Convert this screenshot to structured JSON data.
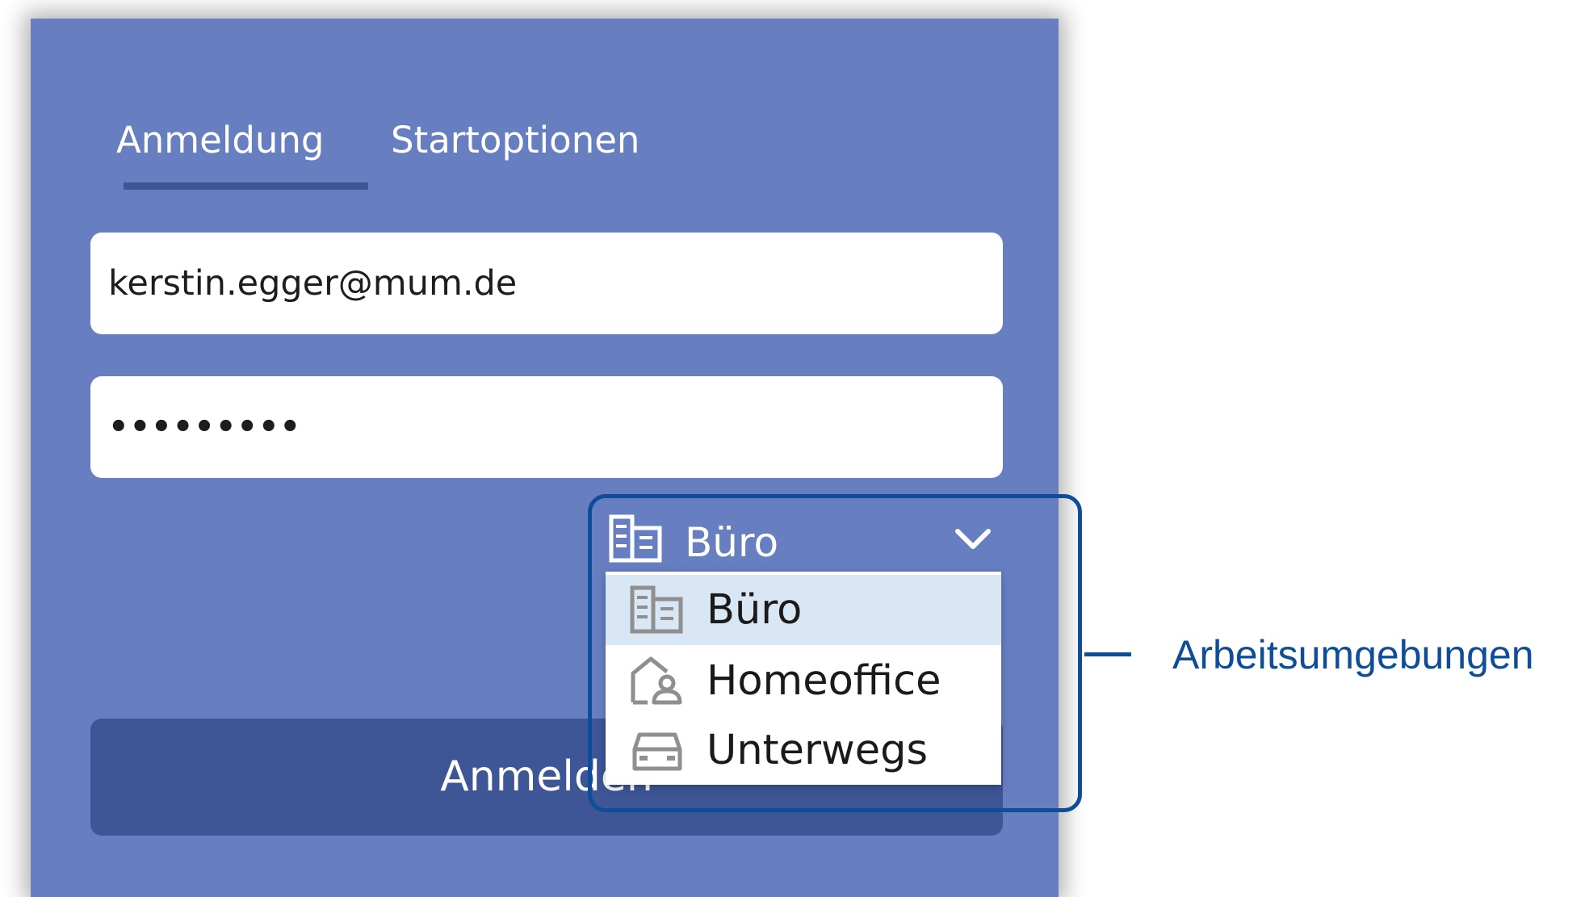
{
  "tabs": [
    {
      "label": "Anmeldung",
      "active": true
    },
    {
      "label": "Startoptionen",
      "active": false
    }
  ],
  "login": {
    "email_value": "kerstin.egger@mum.de",
    "password_value": "•••••••••",
    "submit_label": "Anmelden"
  },
  "environment": {
    "selected_label": "Büro",
    "selected_icon": "office-building-icon",
    "options": [
      {
        "label": "Büro",
        "icon": "office-building-icon",
        "selected": true
      },
      {
        "label": "Homeoffice",
        "icon": "home-person-icon",
        "selected": false
      },
      {
        "label": "Unterwegs",
        "icon": "car-icon",
        "selected": false
      }
    ]
  },
  "annotation": {
    "label": "Arbeitsumgebungen"
  },
  "colors": {
    "panel": "#677fc1",
    "button": "#3e5596",
    "highlight": "#d9e6f4",
    "callout": "#0e4e98"
  }
}
